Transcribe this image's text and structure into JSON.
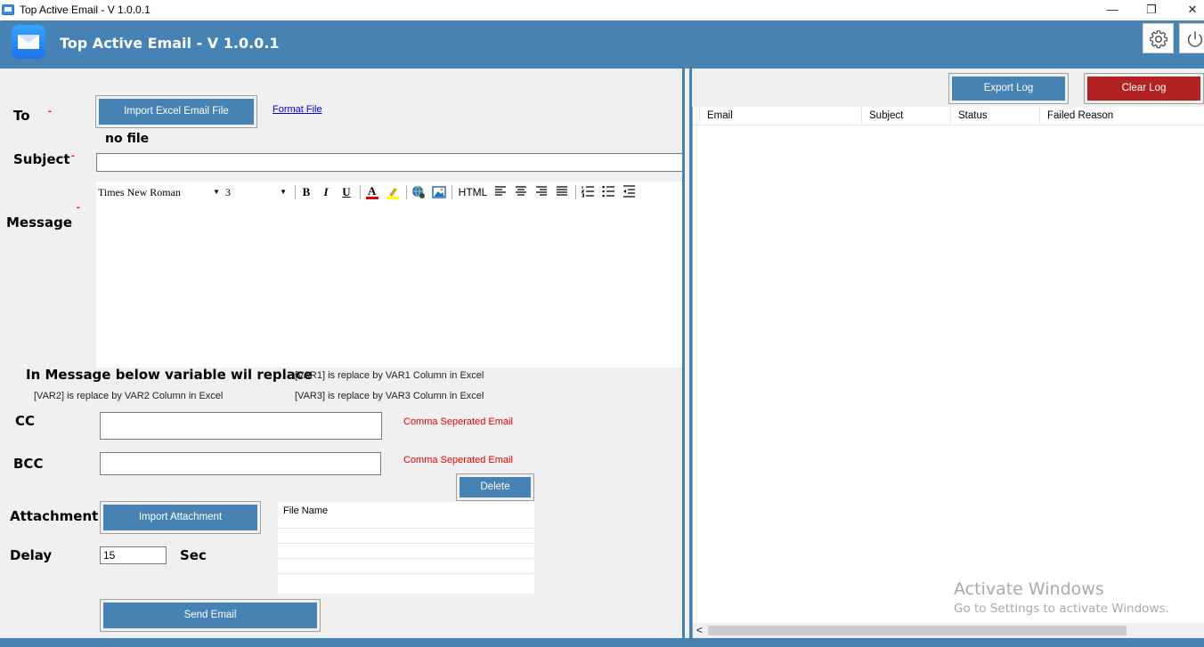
{
  "window": {
    "title": "Top Active Email - V 1.0.0.1",
    "minimize_glyph": "—",
    "restore_glyph": "❐",
    "close_glyph": "✕"
  },
  "header": {
    "title": "Top Active Email - V 1.0.0.1",
    "logo_icon": "mail-icon",
    "settings_icon": "gear-icon",
    "power_icon": "power-icon",
    "accent_color": "#4682b4"
  },
  "form": {
    "to_label": "To",
    "required_mark": "-",
    "import_excel_button": "Import Excel Email File",
    "format_file_link": "Format File",
    "no_file_text": "no file",
    "subject_label": "Subject",
    "subject_value": "",
    "message_label": "Message",
    "editor": {
      "font_name": "Times New Roman",
      "font_size": "3",
      "bold": "B",
      "italic": "I",
      "underline": "U",
      "html_label": "HTML",
      "body": ""
    },
    "variable_heading": "In Message below variable wil replace",
    "var1_note": "[VAR1] is replace by VAR1 Column in Excel",
    "var2_note": "[VAR2] is replace by VAR2 Column in Excel",
    "var3_note": "[VAR3] is replace by VAR3 Column in Excel",
    "cc_label": "CC",
    "cc_value": "",
    "cc_hint": "Comma Seperated Email",
    "bcc_label": "BCC",
    "bcc_value": "",
    "bcc_hint": "Comma Seperated Email",
    "delete_button": "Delete",
    "attachment_label": "Attachment",
    "import_attachment_button": "Import Attachment",
    "attachment_grid": {
      "header": "File Name",
      "rows": []
    },
    "delay_label": "Delay",
    "delay_value": "15",
    "delay_unit": "Sec",
    "send_button": "Send Email"
  },
  "log": {
    "export_button": "Export Log",
    "clear_button": "Clear Log",
    "clear_color": "#b22222",
    "columns": [
      "Email",
      "Subject",
      "Status",
      "Failed Reason"
    ],
    "rows": [],
    "scroll_left_glyph": "<"
  },
  "watermark": {
    "line1": "Activate Windows",
    "line2": "Go to Settings to activate Windows."
  }
}
